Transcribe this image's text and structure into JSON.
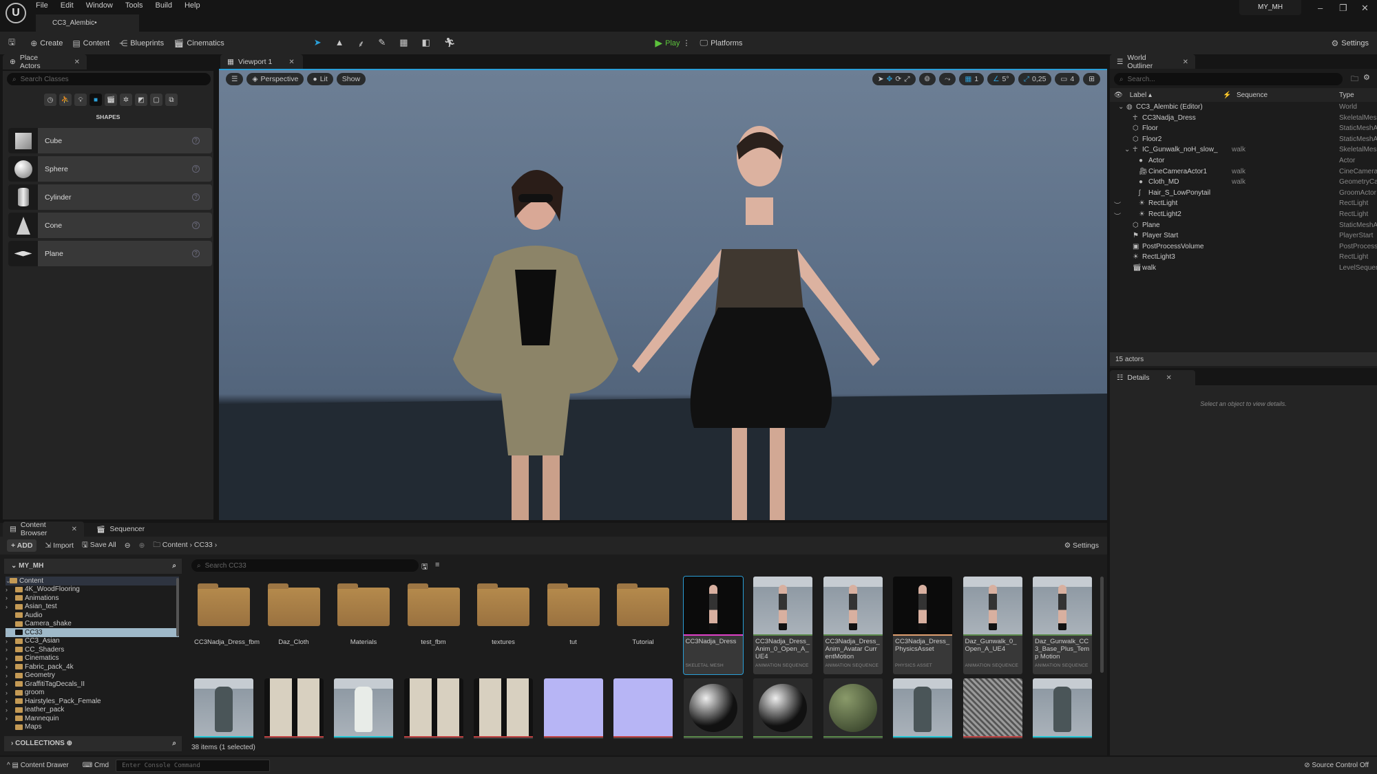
{
  "app": {
    "logo": "U",
    "menu": [
      "File",
      "Edit",
      "Window",
      "Tools",
      "Build",
      "Help"
    ],
    "document_tab": "CC3_Alembic•",
    "project": "MY_MH"
  },
  "toolbar": {
    "create": "Create",
    "content": "Content",
    "blueprints": "Blueprints",
    "cinematics": "Cinematics",
    "play": "Play",
    "platforms": "Platforms",
    "settings": "Settings"
  },
  "place_actors": {
    "tab": "Place Actors",
    "search_placeholder": "Search Classes",
    "section": "SHAPES",
    "items": [
      "Cube",
      "Sphere",
      "Cylinder",
      "Cone",
      "Plane"
    ]
  },
  "viewport": {
    "tab": "Viewport 1",
    "perspective": "Perspective",
    "lit": "Lit",
    "show": "Show",
    "grid_snap": "1",
    "rotation_snap": "5°",
    "scale_snap": "0,25",
    "camera_speed": "4"
  },
  "outliner": {
    "tab": "World Outliner",
    "search_placeholder": "Search...",
    "col_label": "Label",
    "col_sequence": "Sequence",
    "col_type": "Type",
    "rows": [
      {
        "label": "CC3_Alembic (Editor)",
        "sequence": "",
        "type": "World",
        "depth": 0,
        "icon": "world-icon"
      },
      {
        "label": "CC3Nadja_Dress",
        "sequence": "",
        "type": "SkeletalMesh",
        "depth": 1,
        "icon": "skeleton-icon"
      },
      {
        "label": "Floor",
        "sequence": "",
        "type": "StaticMeshActor",
        "depth": 1,
        "icon": "static-mesh-icon"
      },
      {
        "label": "Floor2",
        "sequence": "",
        "type": "StaticMeshActor",
        "depth": 1,
        "icon": "static-mesh-icon"
      },
      {
        "label": "IC_Gunwalk_noH_slow_",
        "sequence": "walk",
        "type": "SkeletalMesh",
        "depth": 1,
        "icon": "skeleton-icon"
      },
      {
        "label": "Actor",
        "sequence": "",
        "type": "Actor",
        "depth": 2,
        "icon": "actor-icon"
      },
      {
        "label": "CineCameraActor1",
        "sequence": "walk",
        "type": "CineCameraActor",
        "depth": 2,
        "icon": "camera-icon"
      },
      {
        "label": "Cloth_MD",
        "sequence": "walk",
        "type": "GeometryCache",
        "depth": 2,
        "icon": "actor-icon"
      },
      {
        "label": "Hair_S_LowPonytail",
        "sequence": "",
        "type": "GroomActor",
        "depth": 2,
        "icon": "groom-icon"
      },
      {
        "label": "RectLight",
        "sequence": "",
        "type": "RectLight",
        "depth": 2,
        "icon": "light-icon"
      },
      {
        "label": "RectLight2",
        "sequence": "",
        "type": "RectLight",
        "depth": 2,
        "icon": "light-icon"
      },
      {
        "label": "Plane",
        "sequence": "",
        "type": "StaticMeshActor",
        "depth": 1,
        "icon": "static-mesh-icon"
      },
      {
        "label": "Player Start",
        "sequence": "",
        "type": "PlayerStart",
        "depth": 1,
        "icon": "player-start-icon"
      },
      {
        "label": "PostProcessVolume",
        "sequence": "",
        "type": "PostProcessVolume",
        "depth": 1,
        "icon": "volume-icon"
      },
      {
        "label": "RectLight3",
        "sequence": "",
        "type": "RectLight",
        "depth": 1,
        "icon": "light-icon"
      },
      {
        "label": "walk",
        "sequence": "",
        "type": "LevelSequenceActor",
        "depth": 1,
        "icon": "sequence-icon"
      }
    ],
    "actor_count": "15 actors"
  },
  "details": {
    "tab": "Details",
    "empty": "Select an object to view details."
  },
  "content_browser": {
    "tab": "Content Browser",
    "sequencer_tab": "Sequencer",
    "add": "ADD",
    "import": "Import",
    "save_all": "Save All",
    "path": [
      "Content",
      "CC33"
    ],
    "settings": "Settings",
    "root": "MY_MH",
    "search_placeholder": "Search CC33",
    "collections": "COLLECTIONS",
    "status": "38 items (1 selected)",
    "tree": [
      {
        "name": "Content",
        "open": true,
        "depth": 0
      },
      {
        "name": "4K_WoodFlooring",
        "depth": 1,
        "exp": true
      },
      {
        "name": "Animations",
        "depth": 1,
        "exp": true
      },
      {
        "name": "Asian_test",
        "depth": 1,
        "exp": true
      },
      {
        "name": "Audio",
        "depth": 1
      },
      {
        "name": "Camera_shake",
        "depth": 1
      },
      {
        "name": "CC33",
        "depth": 1,
        "exp": true,
        "selected": true
      },
      {
        "name": "CC3_Asian",
        "depth": 1,
        "exp": true
      },
      {
        "name": "CC_Shaders",
        "depth": 1,
        "exp": true
      },
      {
        "name": "Cinematics",
        "depth": 1,
        "exp": true
      },
      {
        "name": "Fabric_pack_4k",
        "depth": 1,
        "exp": true
      },
      {
        "name": "Geometry",
        "depth": 1,
        "exp": true
      },
      {
        "name": "GraffitiTagDecals_II",
        "depth": 1,
        "exp": true
      },
      {
        "name": "groom",
        "depth": 1,
        "exp": true
      },
      {
        "name": "Hairstyles_Pack_Female",
        "depth": 1,
        "exp": true
      },
      {
        "name": "leather_pack",
        "depth": 1,
        "exp": true
      },
      {
        "name": "Mannequin",
        "depth": 1,
        "exp": true
      },
      {
        "name": "Maps",
        "depth": 1
      }
    ],
    "folders": [
      "CC3Nadja_Dress_fbm",
      "Daz_Cloth",
      "Materials",
      "test_fbm",
      "textures",
      "tut",
      "Tutorial"
    ],
    "assets": [
      {
        "name": "CC3Nadja_Dress",
        "type": "SKELETAL MESH",
        "color": "#e040c8",
        "selected": true,
        "bg": "dark"
      },
      {
        "name": "CC3Nadja_Dress_Anim_0_Open_A_UE4",
        "type": "ANIMATION SEQUENCE",
        "color": "#5a8a4a",
        "bg": "grid"
      },
      {
        "name": "CC3Nadja_Dress_Anim_Avatar CurrentMotion",
        "type": "ANIMATION SEQUENCE",
        "color": "#5a8a4a",
        "bg": "grid"
      },
      {
        "name": "CC3Nadja_Dress_PhysicsAsset",
        "type": "PHYSICS ASSET",
        "color": "#e0a070",
        "bg": "dark"
      },
      {
        "name": "Daz_Gunwalk_0_Open_A_UE4",
        "type": "ANIMATION SEQUENCE",
        "color": "#5a8a4a",
        "bg": "grid"
      },
      {
        "name": "Daz_Gunwalk_CC3_Base_Plus_Temp Motion",
        "type": "ANIMATION SEQUENCE",
        "color": "#5a8a4a",
        "bg": "grid"
      }
    ],
    "row2_colors": [
      "#20c8d8",
      "#c04040",
      "#20c8d8",
      "#c04040",
      "#c04040",
      "#c04040",
      "#c04040",
      "#5a8a4a",
      "#5a8a4a",
      "#5a8a4a",
      "#20c8d8",
      "#c04040",
      "#20c8d8"
    ],
    "row2_kinds": [
      "dress",
      "pattern",
      "dress-white",
      "pattern",
      "pattern",
      "lavender",
      "lavender",
      "ball",
      "ball",
      "green-ball",
      "dress",
      "texture",
      "dress"
    ]
  },
  "statusbar": {
    "content_drawer": "Content Drawer",
    "cmd": "Cmd",
    "console_placeholder": "Enter Console Command",
    "source_control": "Source Control Off"
  },
  "colors": {
    "accent": "#2a9fd8",
    "play": "#5cc23c",
    "selected_tree": "#9fb9c9"
  }
}
